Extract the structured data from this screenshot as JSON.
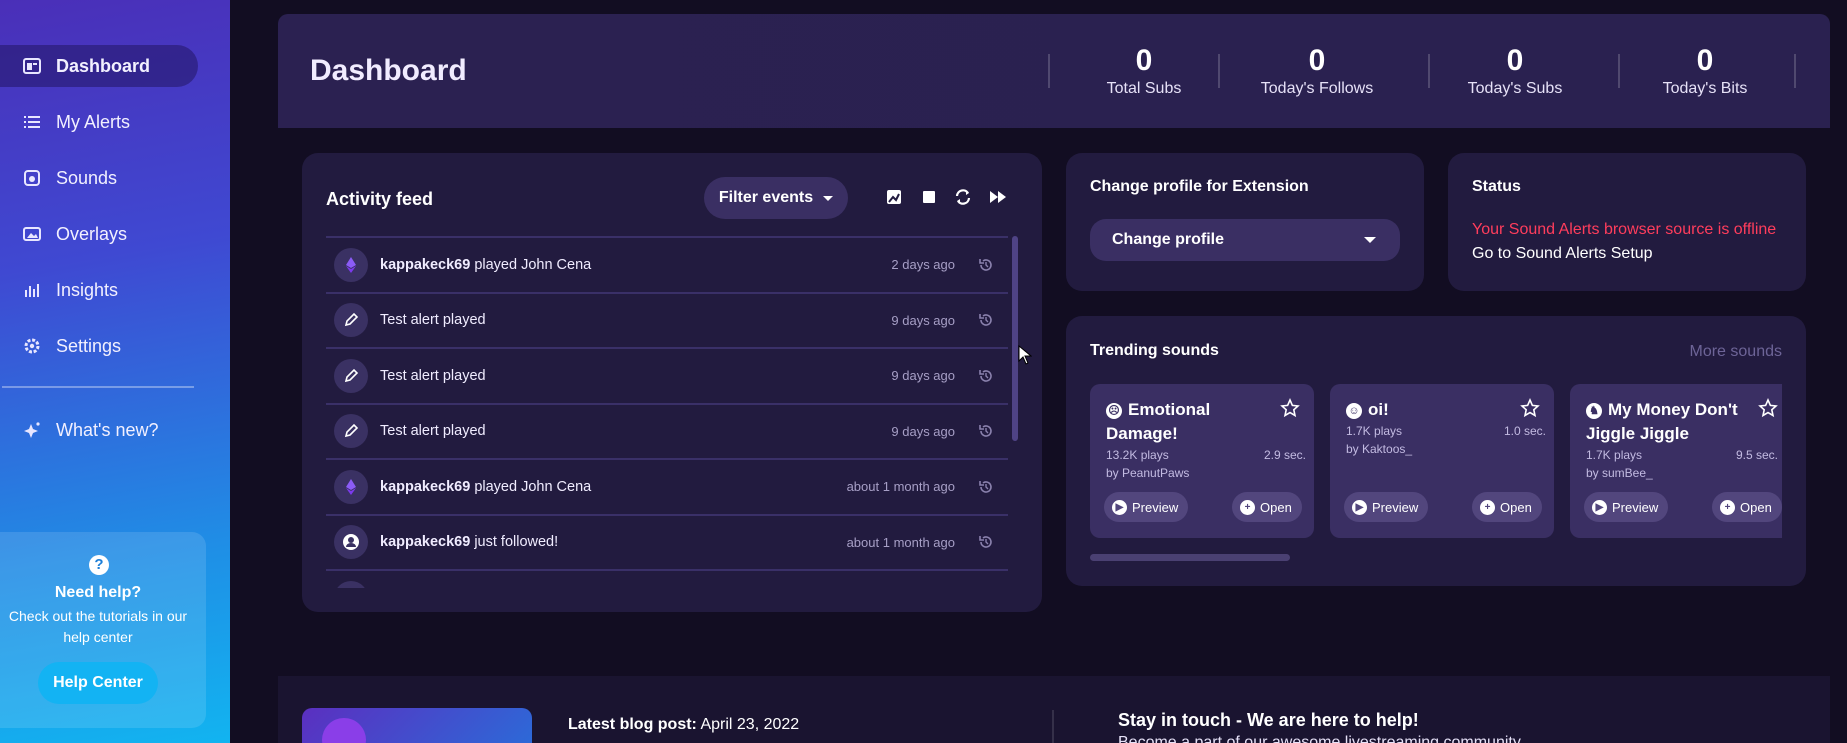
{
  "sidebar": {
    "items": [
      {
        "label": "Dashboard",
        "icon": "dashboard-icon"
      },
      {
        "label": "My Alerts",
        "icon": "list-icon"
      },
      {
        "label": "Sounds",
        "icon": "speaker-icon"
      },
      {
        "label": "Overlays",
        "icon": "image-icon"
      },
      {
        "label": "Insights",
        "icon": "bar-chart-icon"
      },
      {
        "label": "Settings",
        "icon": "gear-icon"
      },
      {
        "label": "What's new?",
        "icon": "sparkle-icon"
      }
    ],
    "help": {
      "title": "Need help?",
      "text": "Check out the tutorials in our help center",
      "button": "Help Center"
    }
  },
  "header": {
    "title": "Dashboard",
    "stats": [
      {
        "value": "0",
        "label": "Total Subs"
      },
      {
        "value": "0",
        "label": "Today's Follows"
      },
      {
        "value": "0",
        "label": "Today's Subs"
      },
      {
        "value": "0",
        "label": "Today's Bits"
      }
    ]
  },
  "feed": {
    "title": "Activity feed",
    "filter_label": "Filter events",
    "rows": [
      {
        "user": "kappakeck69",
        "text": " played John Cena",
        "time": "2 days ago",
        "icon": "ethereum-icon"
      },
      {
        "user": "",
        "text": "Test alert played",
        "time": "9 days ago",
        "icon": "pencil-icon"
      },
      {
        "user": "",
        "text": "Test alert played",
        "time": "9 days ago",
        "icon": "pencil-icon"
      },
      {
        "user": "",
        "text": "Test alert played",
        "time": "9 days ago",
        "icon": "pencil-icon"
      },
      {
        "user": "kappakeck69",
        "text": " played John Cena",
        "time": "about 1 month ago",
        "icon": "ethereum-icon"
      },
      {
        "user": "kappakeck69",
        "text": " just followed!",
        "time": "about 1 month ago",
        "icon": "user-icon"
      }
    ]
  },
  "extension": {
    "title": "Change profile for Extension",
    "select_value": "Change profile"
  },
  "status": {
    "title": "Status",
    "offline_text": "Your Sound Alerts browser source is offline",
    "setup_link": "Go to Sound Alerts Setup",
    "offline_color": "#ff3d5c"
  },
  "trending": {
    "title": "Trending sounds",
    "more": "More sounds",
    "sounds": [
      {
        "name": "Emotional Damage!",
        "emoji": "☹",
        "plays": "13.2K plays",
        "by": "by PeanutPaws",
        "duration": "2.9 sec."
      },
      {
        "name": "oi!",
        "emoji": "☺",
        "plays": "1.7K plays",
        "by": "by Kaktoos_",
        "duration": "1.0 sec."
      },
      {
        "name": "My Money Don't Jiggle Jiggle",
        "emoji": "♞",
        "plays": "1.7K plays",
        "by": "by sumBee_",
        "duration": "9.5 sec."
      }
    ],
    "preview_label": "Preview",
    "open_label": "Open"
  },
  "bottom": {
    "blog_label": "Latest blog post:",
    "blog_date": "April 23, 2022",
    "stay_title": "Stay in touch - We are here to help!",
    "stay_text": "Become a part of our awesome livestreaming community"
  },
  "colors": {
    "accent": "#13b3f3",
    "card": "#221b3f",
    "background": "#120d22"
  }
}
